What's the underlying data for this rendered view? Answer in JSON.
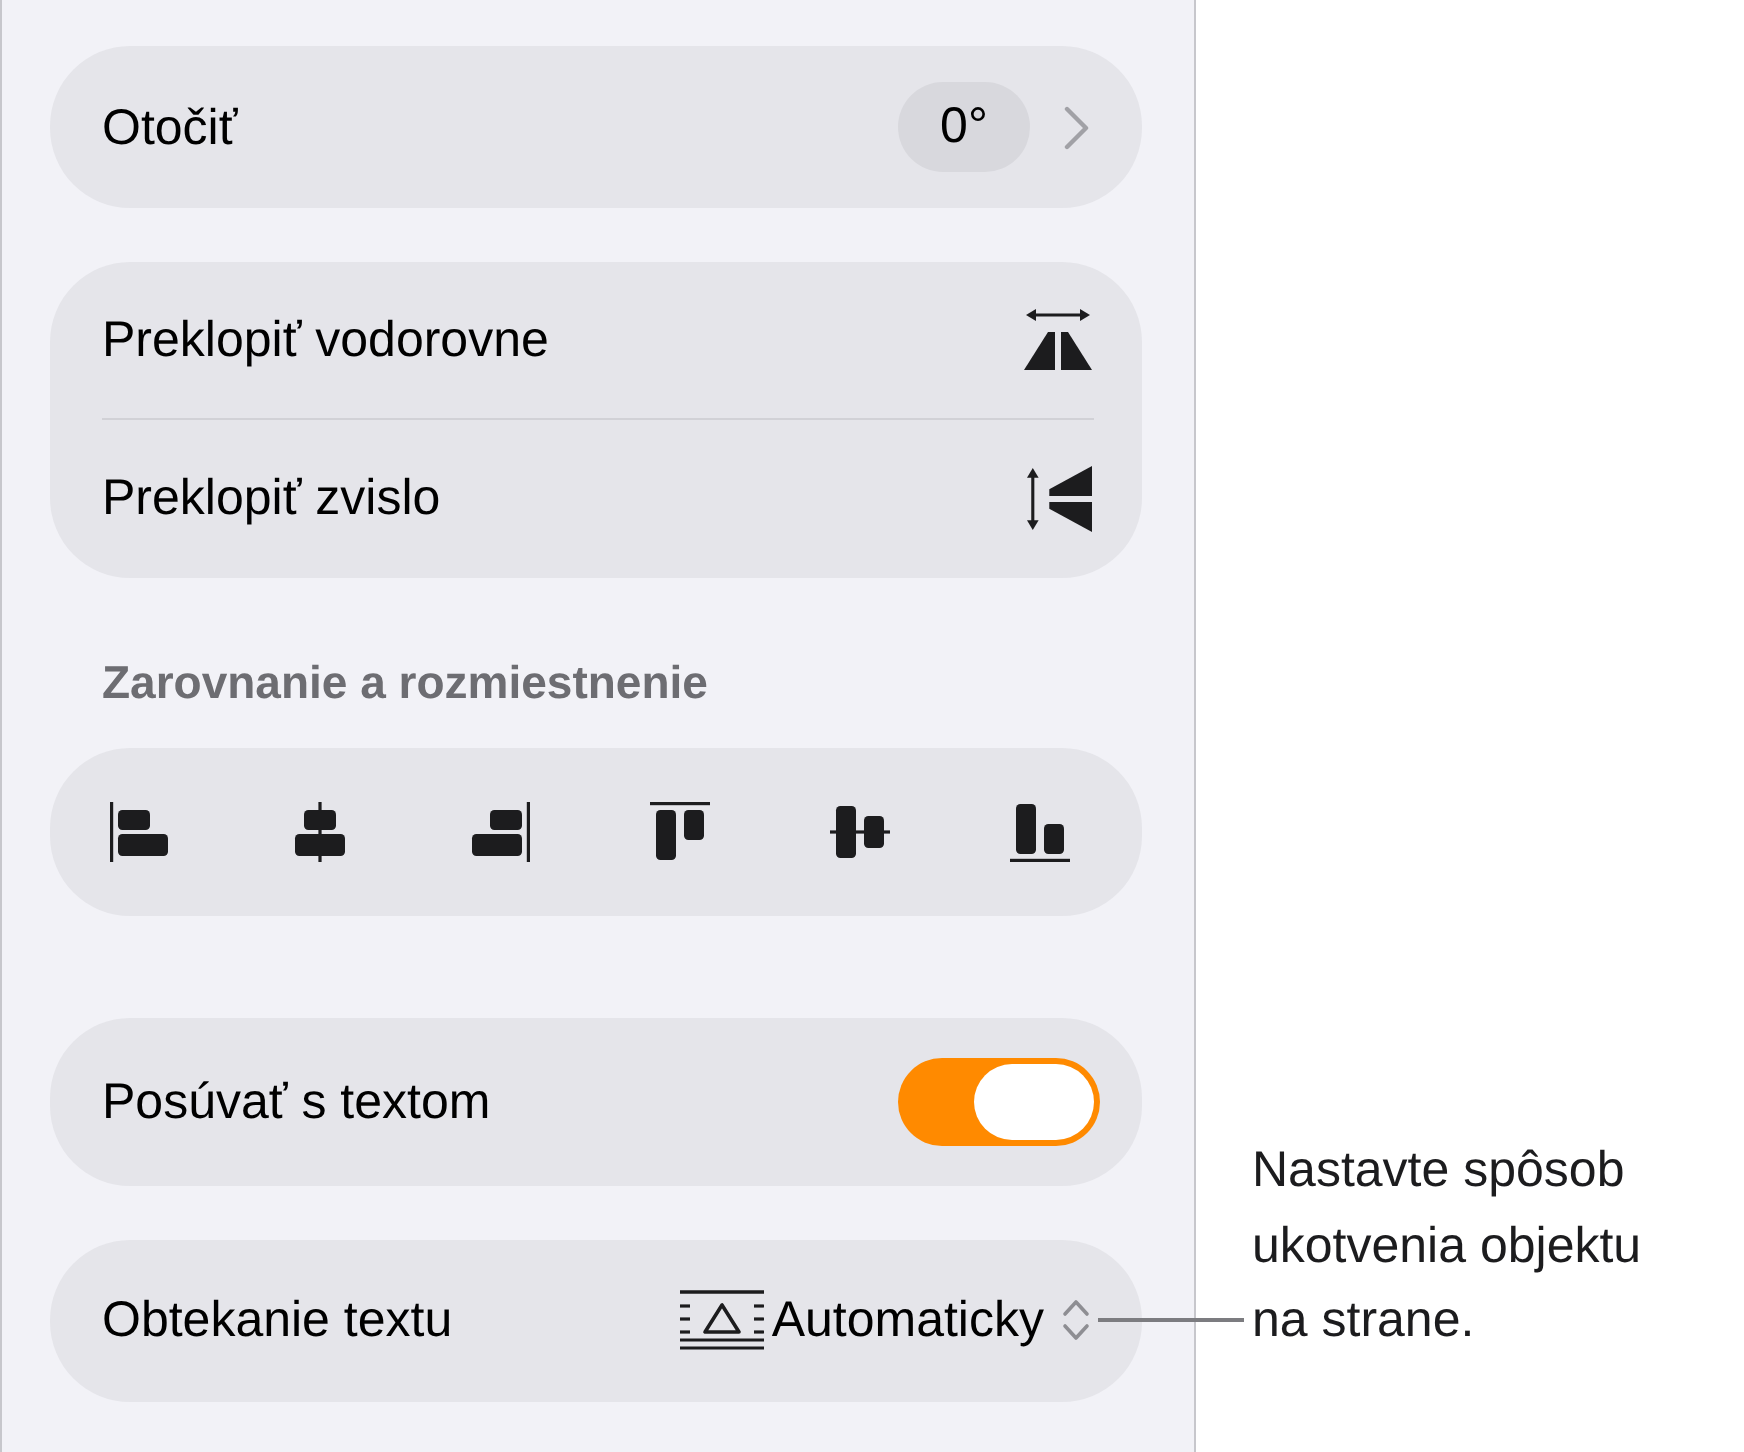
{
  "panel": {
    "rotate": {
      "label": "Otočiť",
      "value": "0°"
    },
    "flip": [
      {
        "label": "Preklopiť vodorovne",
        "kind": "horizontal"
      },
      {
        "label": "Preklopiť zvislo",
        "kind": "vertical"
      }
    ],
    "arrange": {
      "title": "Zarovnanie a rozmiestnenie"
    },
    "move_with_text": {
      "label": "Posúvať s textom",
      "on": true
    },
    "text_wrap": {
      "label": "Obtekanie textu",
      "value": "Automaticky"
    }
  },
  "callout": {
    "text": "Nastavte spôsob ukotvenia objektu na strane."
  }
}
